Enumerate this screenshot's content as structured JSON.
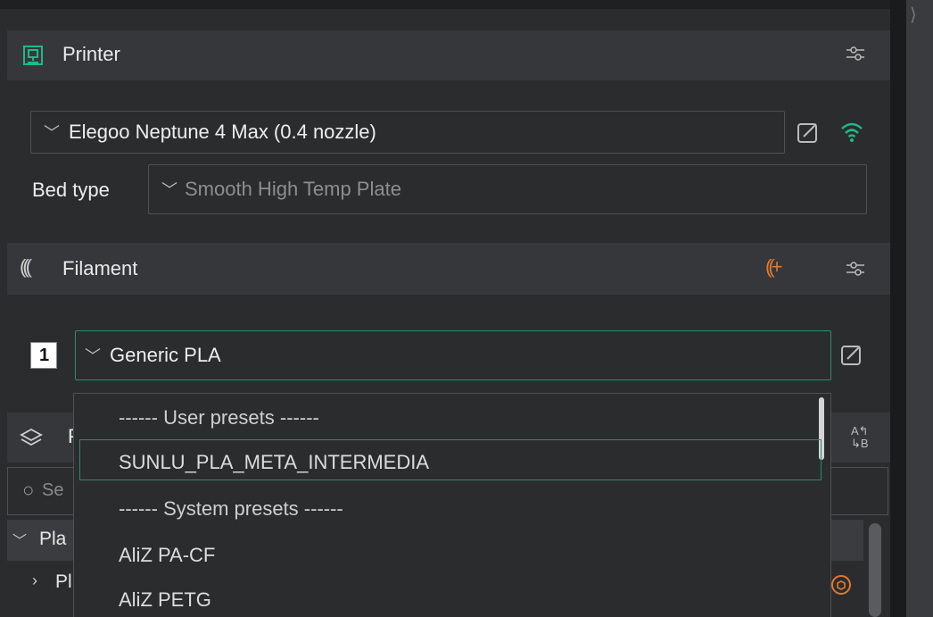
{
  "printer": {
    "title": "Printer",
    "selected_printer": "Elegoo Neptune 4 Max (0.4 nozzle)",
    "bed_type_label": "Bed type",
    "bed_type_value": "Smooth High Temp Plate"
  },
  "filament": {
    "title": "Filament",
    "slot_number": "1",
    "selected": "Generic PLA"
  },
  "process": {
    "title_partial": "P",
    "search_placeholder_partial": "Se",
    "tree_row1": "Pla",
    "tree_row2": "Pl"
  },
  "dropdown": {
    "items": [
      "------ User presets ------",
      "SUNLU_PLA_META_INTERMEDIA",
      "------ System presets ------",
      "AliZ PA-CF",
      "AliZ PETG"
    ]
  },
  "colors": {
    "accent": "#2e8a6e",
    "wifi": "#1fb98a",
    "panel_bg": "#2b2c2e",
    "header_bg": "#36373a",
    "orange_icon": "#e07a2e"
  }
}
